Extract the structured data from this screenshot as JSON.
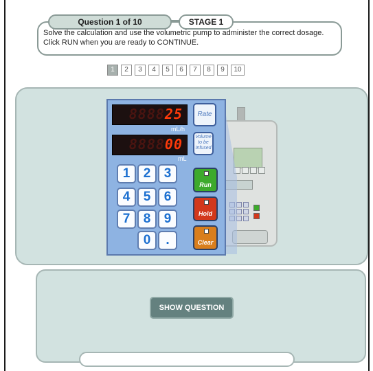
{
  "header": {
    "question_label": "Question 1 of 10",
    "stage_label": "STAGE 1",
    "instruction": "Solve the calculation and use the volumetric pump to administer the correct dosage. Click RUN when you are ready to CONTINUE."
  },
  "question_nav": {
    "current": 1,
    "items": [
      "1",
      "2",
      "3",
      "4",
      "5",
      "6",
      "7",
      "8",
      "9",
      "10"
    ]
  },
  "pump": {
    "rate_display": {
      "dim": "8888",
      "lit": "25",
      "unit": "mL/h"
    },
    "volume_display": {
      "dim": "8888",
      "lit": "00",
      "unit": "mL"
    },
    "rate_button_label": "Rate",
    "volume_button_label": "Volume to be Infused",
    "keys": [
      "1",
      "2",
      "3",
      "4",
      "5",
      "6",
      "7",
      "8",
      "9",
      "0",
      "."
    ],
    "run_label": "Run",
    "hold_label": "Hold",
    "clear_label": "Clear",
    "colors": {
      "run": "#3daa2c",
      "hold": "#d2381c",
      "clear": "#d97e1c",
      "panel": "#8eb3e2",
      "led": "#ff3a0a"
    }
  },
  "lower": {
    "show_question_label": "SHOW QUESTION"
  },
  "colors": {
    "panel_bg": "#d2e2e0",
    "button_bg": "#64817f",
    "active_nav": "#a7b0ad"
  }
}
